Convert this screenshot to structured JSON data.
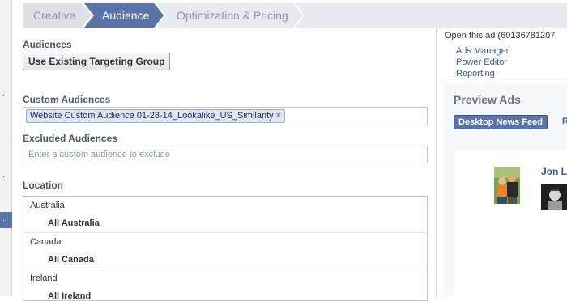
{
  "steps": [
    {
      "label": "Creative",
      "active": false
    },
    {
      "label": "Audience",
      "active": true
    },
    {
      "label": "Optimization & Pricing",
      "active": false
    }
  ],
  "audiences": {
    "label": "Audiences",
    "button": "Use Existing Targeting Group"
  },
  "custom_audiences": {
    "label": "Custom Audiences",
    "token": "Website Custom Audience 01-28-14_Lookalike_US_Similarity",
    "remove_glyph": "×"
  },
  "excluded_audiences": {
    "label": "Excluded Audiences",
    "placeholder": "Enter a custom audience to exclude"
  },
  "location": {
    "label": "Location",
    "rows": [
      {
        "country": "Australia",
        "scope": "All Australia"
      },
      {
        "country": "Canada",
        "scope": "All Canada"
      },
      {
        "country": "Ireland",
        "scope": "All Ireland"
      }
    ]
  },
  "right_panel": {
    "open_ad": "Open this ad (60136781207",
    "links": [
      "Ads Manager",
      "Power Editor",
      "Reporting"
    ],
    "preview_title": "Preview Ads",
    "desktop_button": "Desktop News Feed",
    "next_tab": "R",
    "user_name": "Jon Lo"
  },
  "colors": {
    "brand_blue": "#5b74a8",
    "link_blue": "#3b5998"
  }
}
